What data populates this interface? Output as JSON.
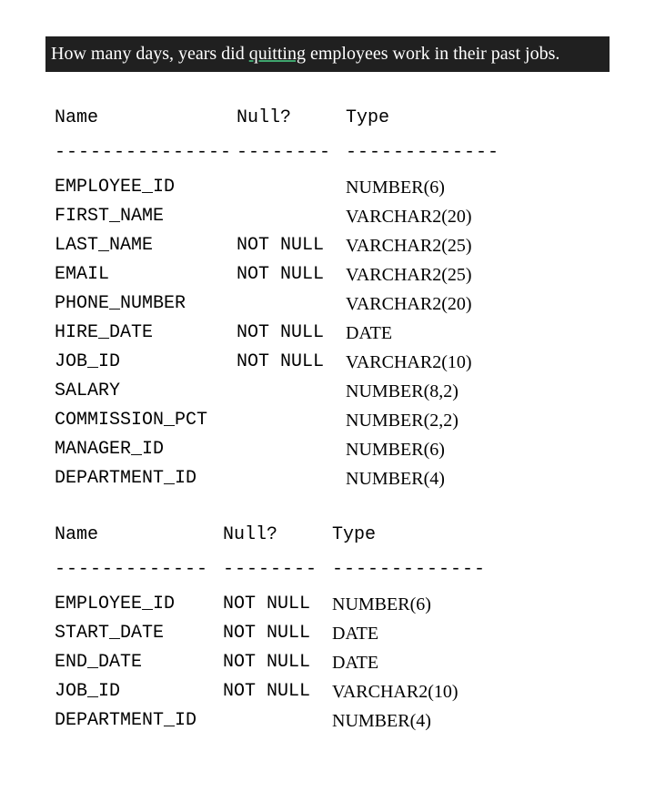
{
  "question": {
    "pre": "How many days, years did ",
    "underlined": "quitting",
    "post": " employees work in their past jobs."
  },
  "schema1": {
    "headers": {
      "name": "Name",
      "null": "Null?",
      "type": "Type"
    },
    "dashes": {
      "name": "---------------",
      "null": "--------",
      "type": "-------------"
    },
    "rows": [
      {
        "name": "EMPLOYEE_ID",
        "null": "",
        "type": "NUMBER(6)"
      },
      {
        "name": "FIRST_NAME",
        "null": "",
        "type": "VARCHAR2(20)"
      },
      {
        "name": "LAST_NAME",
        "null": "NOT NULL",
        "type": "VARCHAR2(25)"
      },
      {
        "name": "EMAIL",
        "null": "NOT NULL",
        "type": "VARCHAR2(25)"
      },
      {
        "name": "PHONE_NUMBER",
        "null": "",
        "type": "VARCHAR2(20)"
      },
      {
        "name": "HIRE_DATE",
        "null": "NOT NULL",
        "type": "DATE"
      },
      {
        "name": "JOB_ID",
        "null": "NOT NULL",
        "type": "VARCHAR2(10)"
      },
      {
        "name": "SALARY",
        "null": "",
        "type": "NUMBER(8,2)"
      },
      {
        "name": "COMMISSION_PCT",
        "null": "",
        "type": "NUMBER(2,2)"
      },
      {
        "name": "MANAGER_ID",
        "null": "",
        "type": "NUMBER(6)"
      },
      {
        "name": "DEPARTMENT_ID",
        "null": "",
        "type": "NUMBER(4)"
      }
    ]
  },
  "schema2": {
    "headers": {
      "name": "Name",
      "null": "Null?",
      "type": "Type"
    },
    "dashes": {
      "name": "-------------",
      "null": "--------",
      "type": "-------------"
    },
    "rows": [
      {
        "name": "EMPLOYEE_ID",
        "null": "NOT NULL",
        "type": "NUMBER(6)"
      },
      {
        "name": "START_DATE",
        "null": "NOT NULL",
        "type": "DATE"
      },
      {
        "name": "END_DATE",
        "null": "NOT NULL",
        "type": "DATE"
      },
      {
        "name": "JOB_ID",
        "null": "NOT NULL",
        "type": "VARCHAR2(10)"
      },
      {
        "name": "DEPARTMENT_ID",
        "null": "",
        "type": "NUMBER(4)"
      }
    ]
  }
}
